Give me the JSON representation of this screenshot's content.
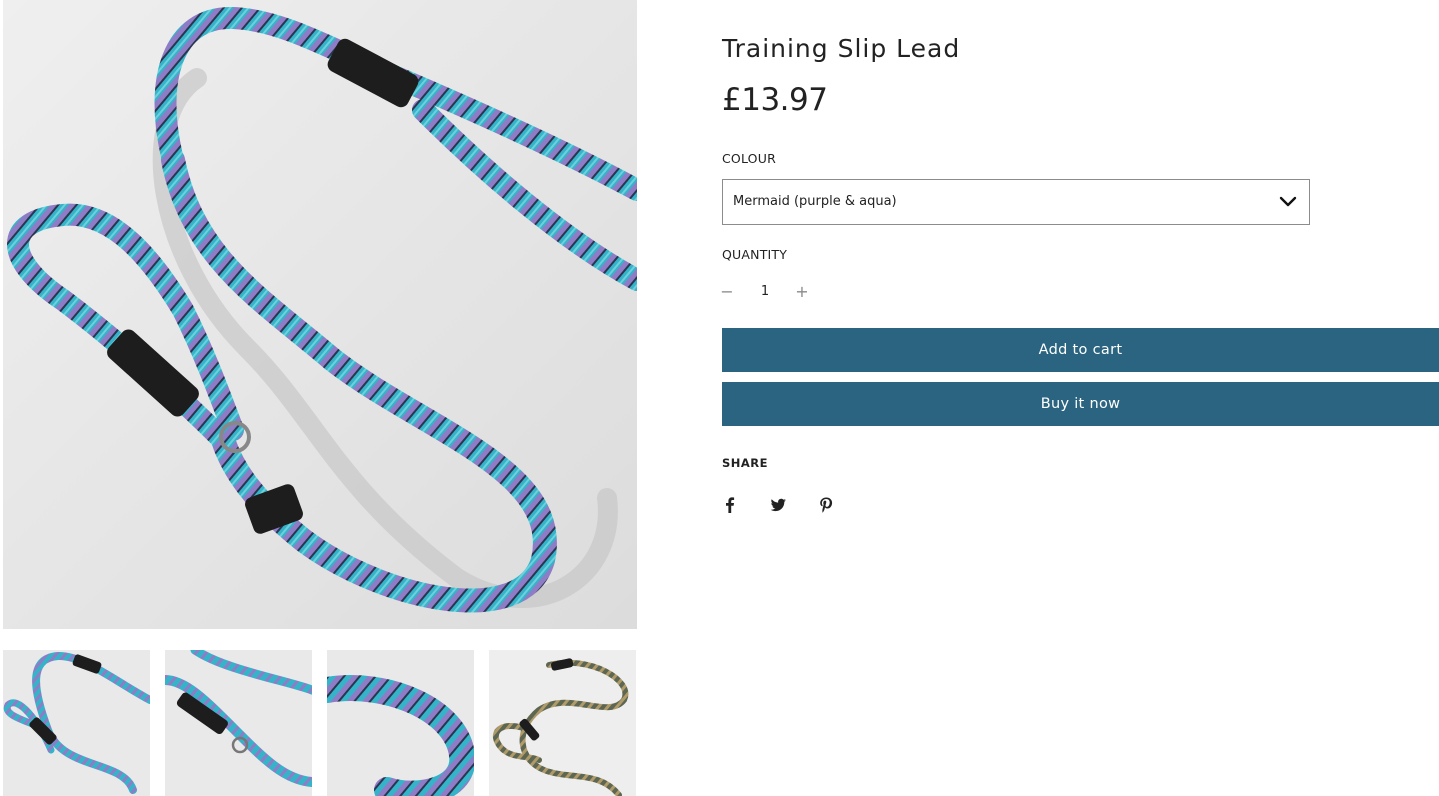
{
  "product": {
    "title": "Training Slip Lead",
    "price": "£13.97"
  },
  "options": {
    "colour_label": "COLOUR",
    "colour_value": "Mermaid (purple & aqua)",
    "quantity_label": "QUANTITY",
    "quantity_value": "1",
    "minus_symbol": "−",
    "plus_symbol": "+"
  },
  "actions": {
    "add_to_cart": "Add to cart",
    "buy_now": "Buy it now"
  },
  "share": {
    "label": "SHARE",
    "icons": [
      "facebook-icon",
      "twitter-icon",
      "pinterest-icon"
    ]
  },
  "colors": {
    "button": "#2a6480",
    "rope_main": "#35b3c9",
    "rope_pattern": "#8f7cc7",
    "leather": "#1d1d1d",
    "backdrop": "#e6e6e6"
  },
  "gallery": {
    "thumbnail_count": 4
  }
}
